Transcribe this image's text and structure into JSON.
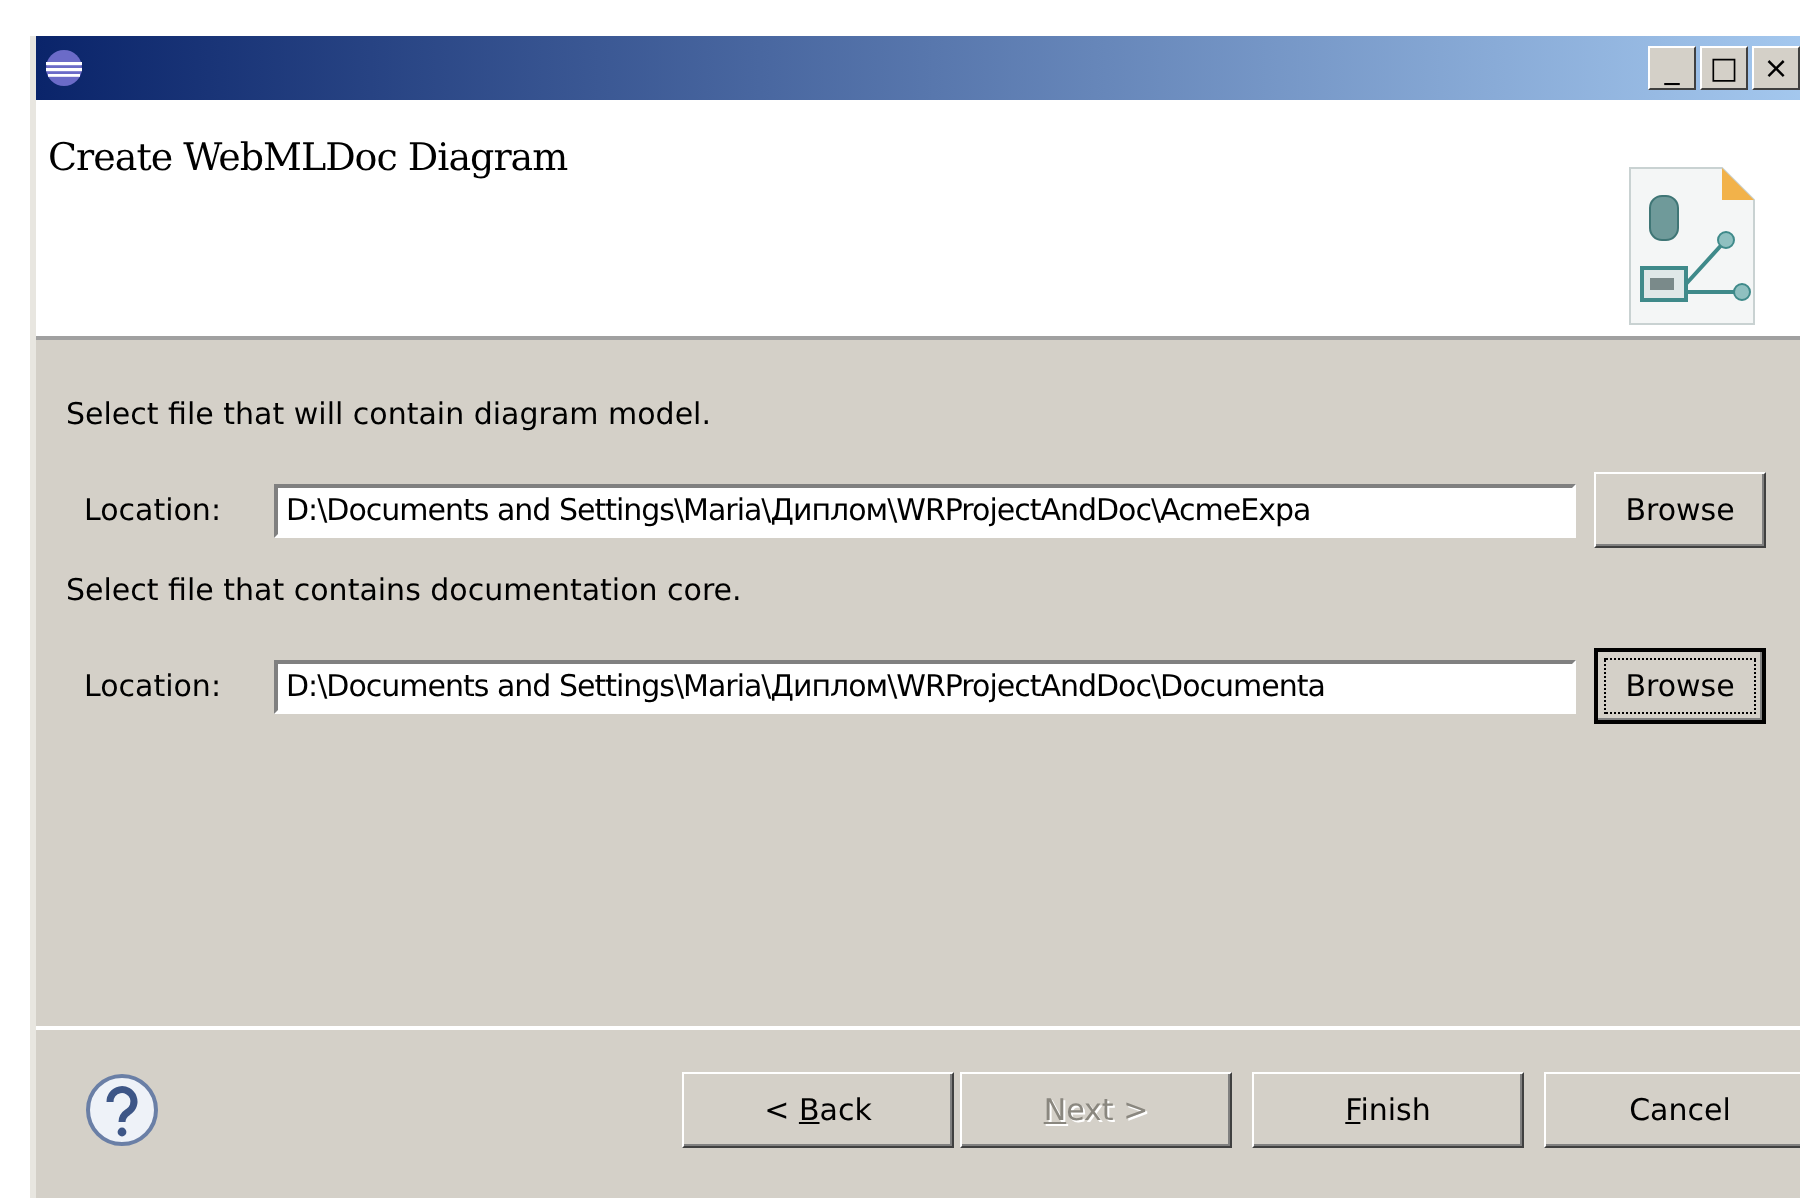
{
  "window": {
    "title_bar_buttons": [
      "_",
      "□",
      "×"
    ]
  },
  "header": {
    "title": "Create WebMLDoc Diagram"
  },
  "sections": [
    {
      "instruction": "Select file that will contain diagram model.",
      "label": "Location:",
      "value": "D:\\Documents and Settings\\Maria\\Диплом\\WRProjectAndDoc\\AcmeExpa",
      "button": {
        "label": "Browse",
        "focused": false
      }
    },
    {
      "instruction": "Select file that contains documentation core.",
      "label": "Location:",
      "value": "D:\\Documents and Settings\\Maria\\Диплом\\WRProjectAndDoc\\Documenta",
      "button": {
        "label": "Browse",
        "focused": true
      }
    }
  ],
  "buttons": [
    {
      "label_before": "< ",
      "mnemonic": "B",
      "label_after": "ack",
      "disabled": false
    },
    {
      "mnemonic": "N",
      "label_after": "ext >",
      "disabled": true
    },
    {
      "mnemonic": "F",
      "label_after": "inish",
      "disabled": false
    },
    {
      "label_before": "Cancel",
      "disabled": false
    }
  ]
}
